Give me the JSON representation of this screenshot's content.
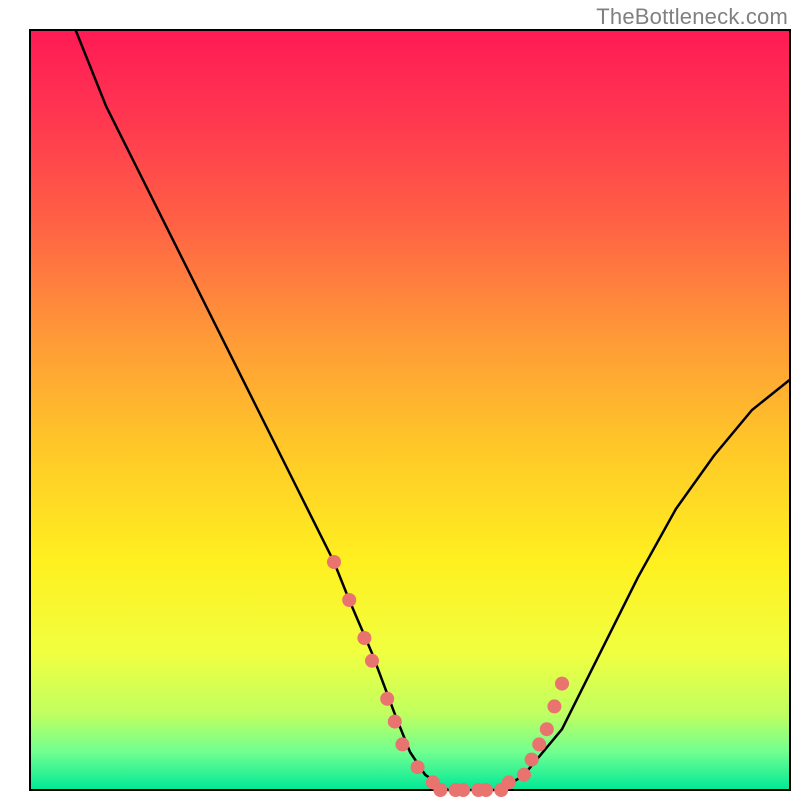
{
  "watermark": "TheBottleneck.com",
  "chart_data": {
    "type": "line",
    "title": "",
    "xlabel": "",
    "ylabel": "",
    "xlim": [
      0,
      100
    ],
    "ylim": [
      0,
      100
    ],
    "grid": false,
    "legend": false,
    "background": {
      "type": "vertical-gradient",
      "stops": [
        {
          "offset": 0,
          "color": "#ff1a4d"
        },
        {
          "offset": 20,
          "color": "#ff5040"
        },
        {
          "offset": 40,
          "color": "#ffa030"
        },
        {
          "offset": 60,
          "color": "#ffe020"
        },
        {
          "offset": 80,
          "color": "#f0ff40"
        },
        {
          "offset": 95,
          "color": "#80ff80"
        },
        {
          "offset": 100,
          "color": "#00e090"
        }
      ]
    },
    "series": [
      {
        "name": "bottleneck-curve",
        "x": [
          6,
          10,
          15,
          20,
          25,
          30,
          35,
          40,
          42,
          45,
          48,
          50,
          52,
          55,
          58,
          60,
          62,
          65,
          70,
          75,
          80,
          85,
          90,
          95,
          100
        ],
        "y": [
          100,
          90,
          80,
          70,
          60,
          50,
          40,
          30,
          25,
          18,
          10,
          5,
          2,
          0,
          0,
          0,
          0,
          2,
          8,
          18,
          28,
          37,
          44,
          50,
          54
        ],
        "color": "#000000",
        "linewidth": 2
      }
    ],
    "markers": [
      {
        "name": "data-points",
        "color": "#e8736f",
        "radius": 7,
        "points": [
          {
            "x": 40,
            "y": 30
          },
          {
            "x": 42,
            "y": 25
          },
          {
            "x": 44,
            "y": 20
          },
          {
            "x": 45,
            "y": 17
          },
          {
            "x": 47,
            "y": 12
          },
          {
            "x": 48,
            "y": 9
          },
          {
            "x": 49,
            "y": 6
          },
          {
            "x": 51,
            "y": 3
          },
          {
            "x": 53,
            "y": 1
          },
          {
            "x": 54,
            "y": 0
          },
          {
            "x": 56,
            "y": 0
          },
          {
            "x": 57,
            "y": 0
          },
          {
            "x": 59,
            "y": 0
          },
          {
            "x": 60,
            "y": 0
          },
          {
            "x": 62,
            "y": 0
          },
          {
            "x": 63,
            "y": 1
          },
          {
            "x": 65,
            "y": 2
          },
          {
            "x": 66,
            "y": 4
          },
          {
            "x": 67,
            "y": 6
          },
          {
            "x": 68,
            "y": 8
          },
          {
            "x": 69,
            "y": 11
          },
          {
            "x": 70,
            "y": 14
          }
        ]
      }
    ]
  }
}
